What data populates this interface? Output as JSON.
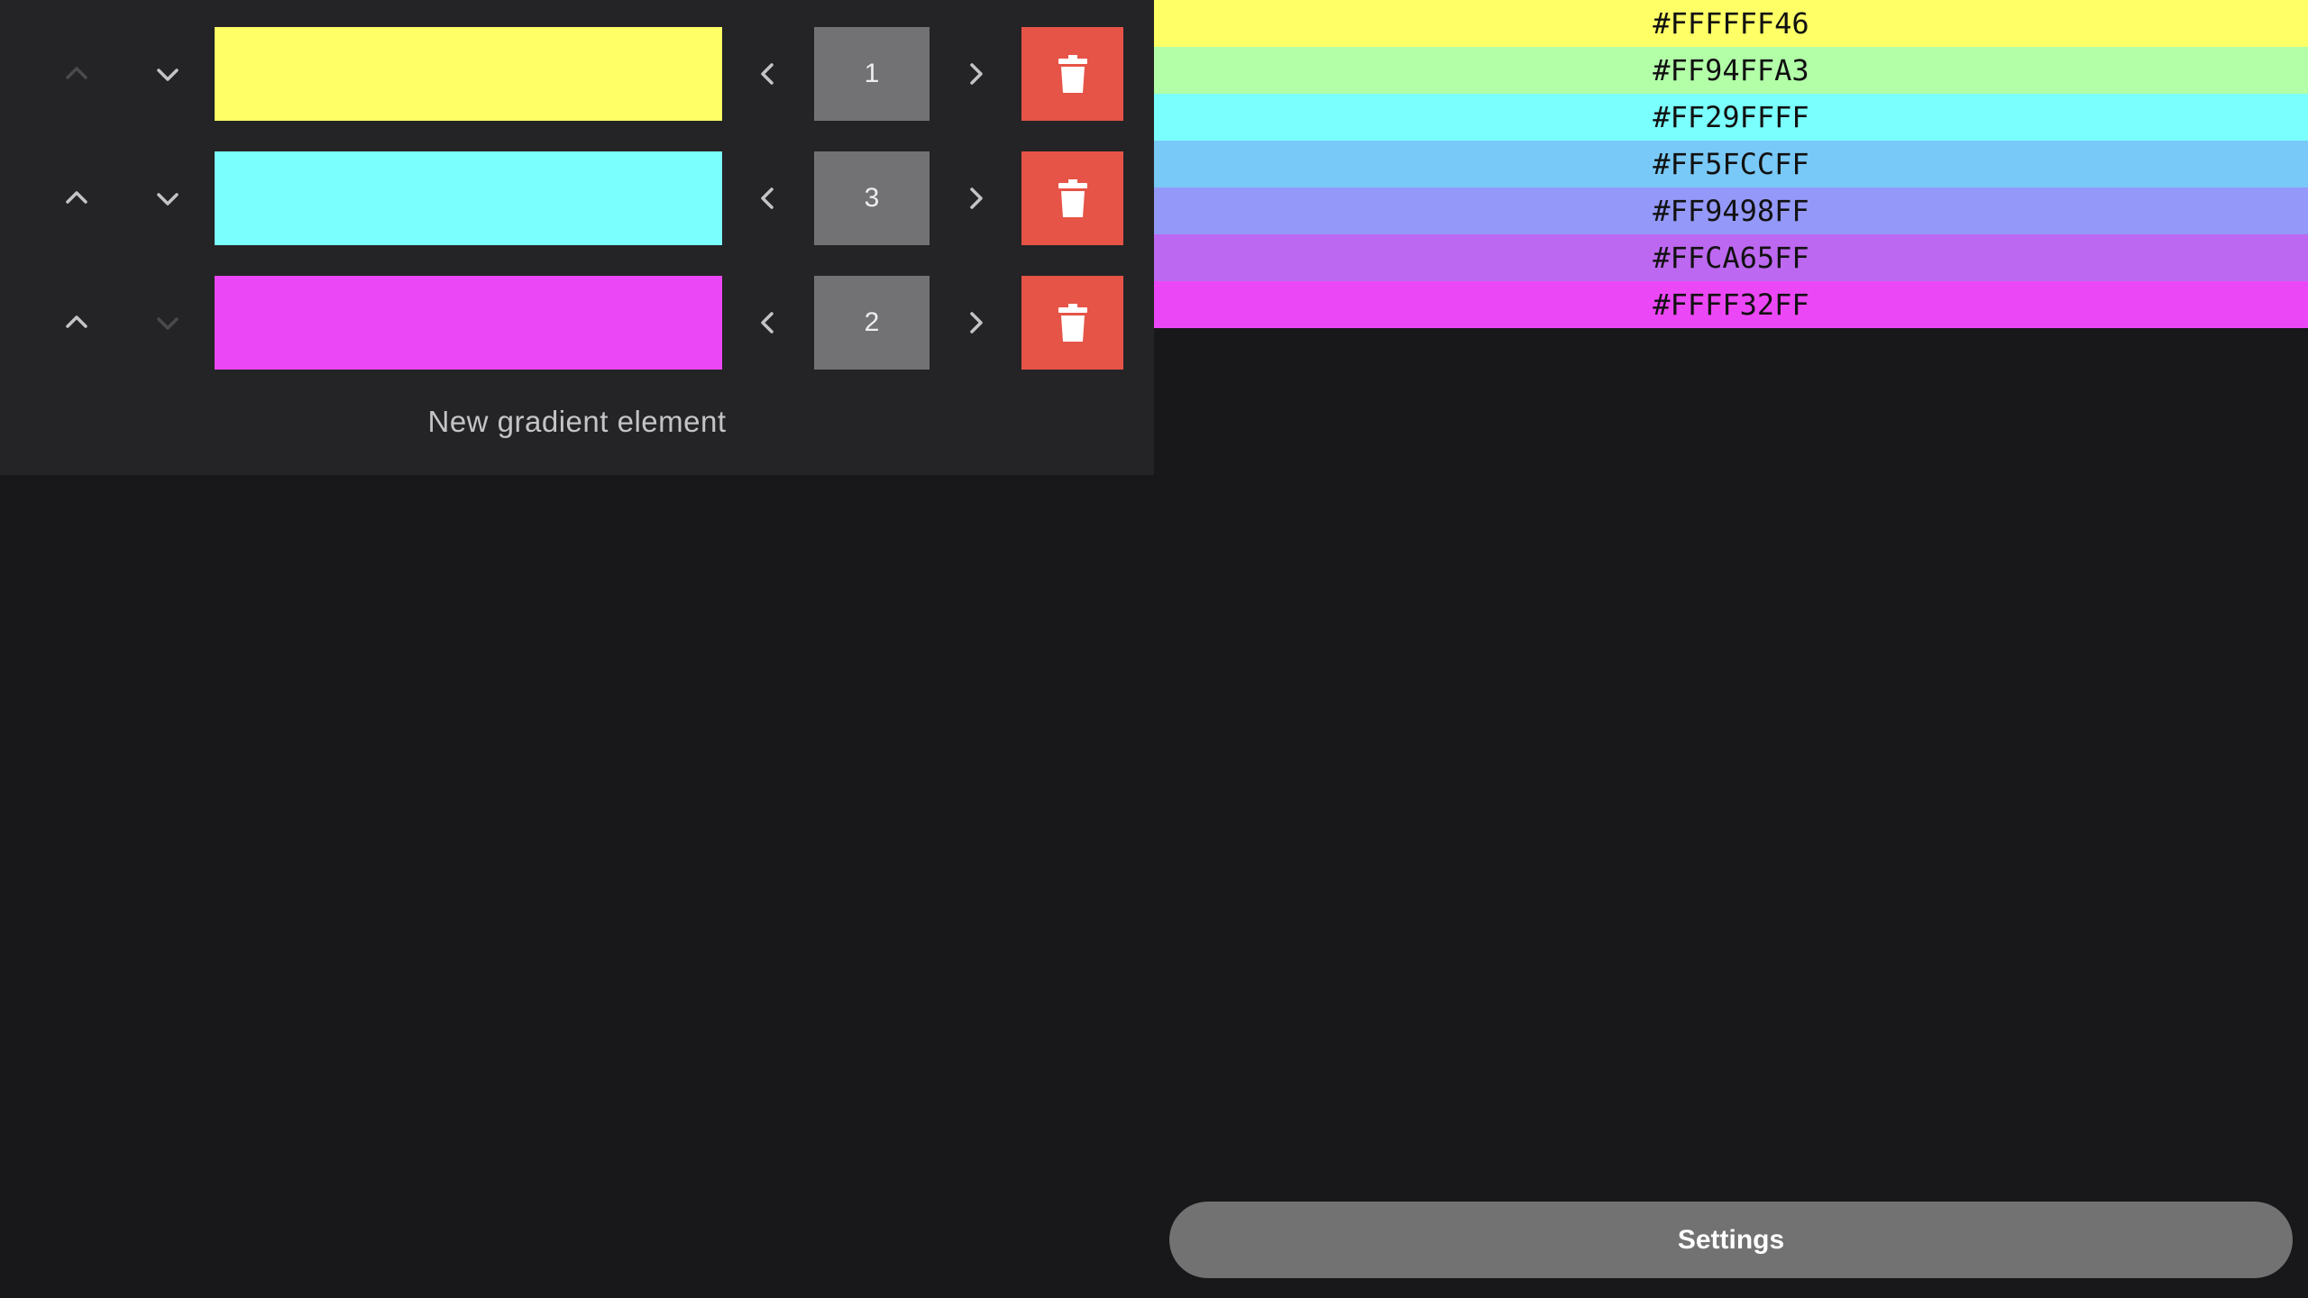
{
  "editor": {
    "rows": [
      {
        "color": "#ffff66",
        "weight": "1",
        "move_up_enabled": false,
        "move_down_enabled": true,
        "up_icon": "chevron-up-icon",
        "down_icon": "chevron-down-icon",
        "prev_icon": "chevron-left-icon",
        "next_icon": "chevron-right-icon",
        "delete_icon": "trash-icon"
      },
      {
        "color": "#7afffe",
        "weight": "3",
        "move_up_enabled": true,
        "move_down_enabled": true,
        "up_icon": "chevron-up-icon",
        "down_icon": "chevron-down-icon",
        "prev_icon": "chevron-left-icon",
        "next_icon": "chevron-right-icon",
        "delete_icon": "trash-icon"
      },
      {
        "color": "#ec47f6",
        "weight": "2",
        "move_up_enabled": true,
        "move_down_enabled": false,
        "up_icon": "chevron-up-icon",
        "down_icon": "chevron-down-icon",
        "prev_icon": "chevron-left-icon",
        "next_icon": "chevron-right-icon",
        "delete_icon": "trash-icon"
      }
    ],
    "new_element_label": "New gradient element"
  },
  "preview": {
    "bands": [
      {
        "label": "#FFFFFF46",
        "color": "#ffff66"
      },
      {
        "label": "#FF94FFA3",
        "color": "#b2ffa8"
      },
      {
        "label": "#FF29FFFF",
        "color": "#7afffe"
      },
      {
        "label": "#FF5FCCFF",
        "color": "#79c9f8"
      },
      {
        "label": "#FF9498FF",
        "color": "#9498f8"
      },
      {
        "label": "#FFCA65FF",
        "color": "#bd68f0"
      },
      {
        "label": "#FFFF32FF",
        "color": "#ec47f6"
      }
    ]
  },
  "settings": {
    "label": "Settings"
  },
  "colors": {
    "background": "#18181a",
    "panel": "#242426",
    "delete": "#e65347",
    "weight_box": "#727274",
    "settings_button": "#727272"
  }
}
